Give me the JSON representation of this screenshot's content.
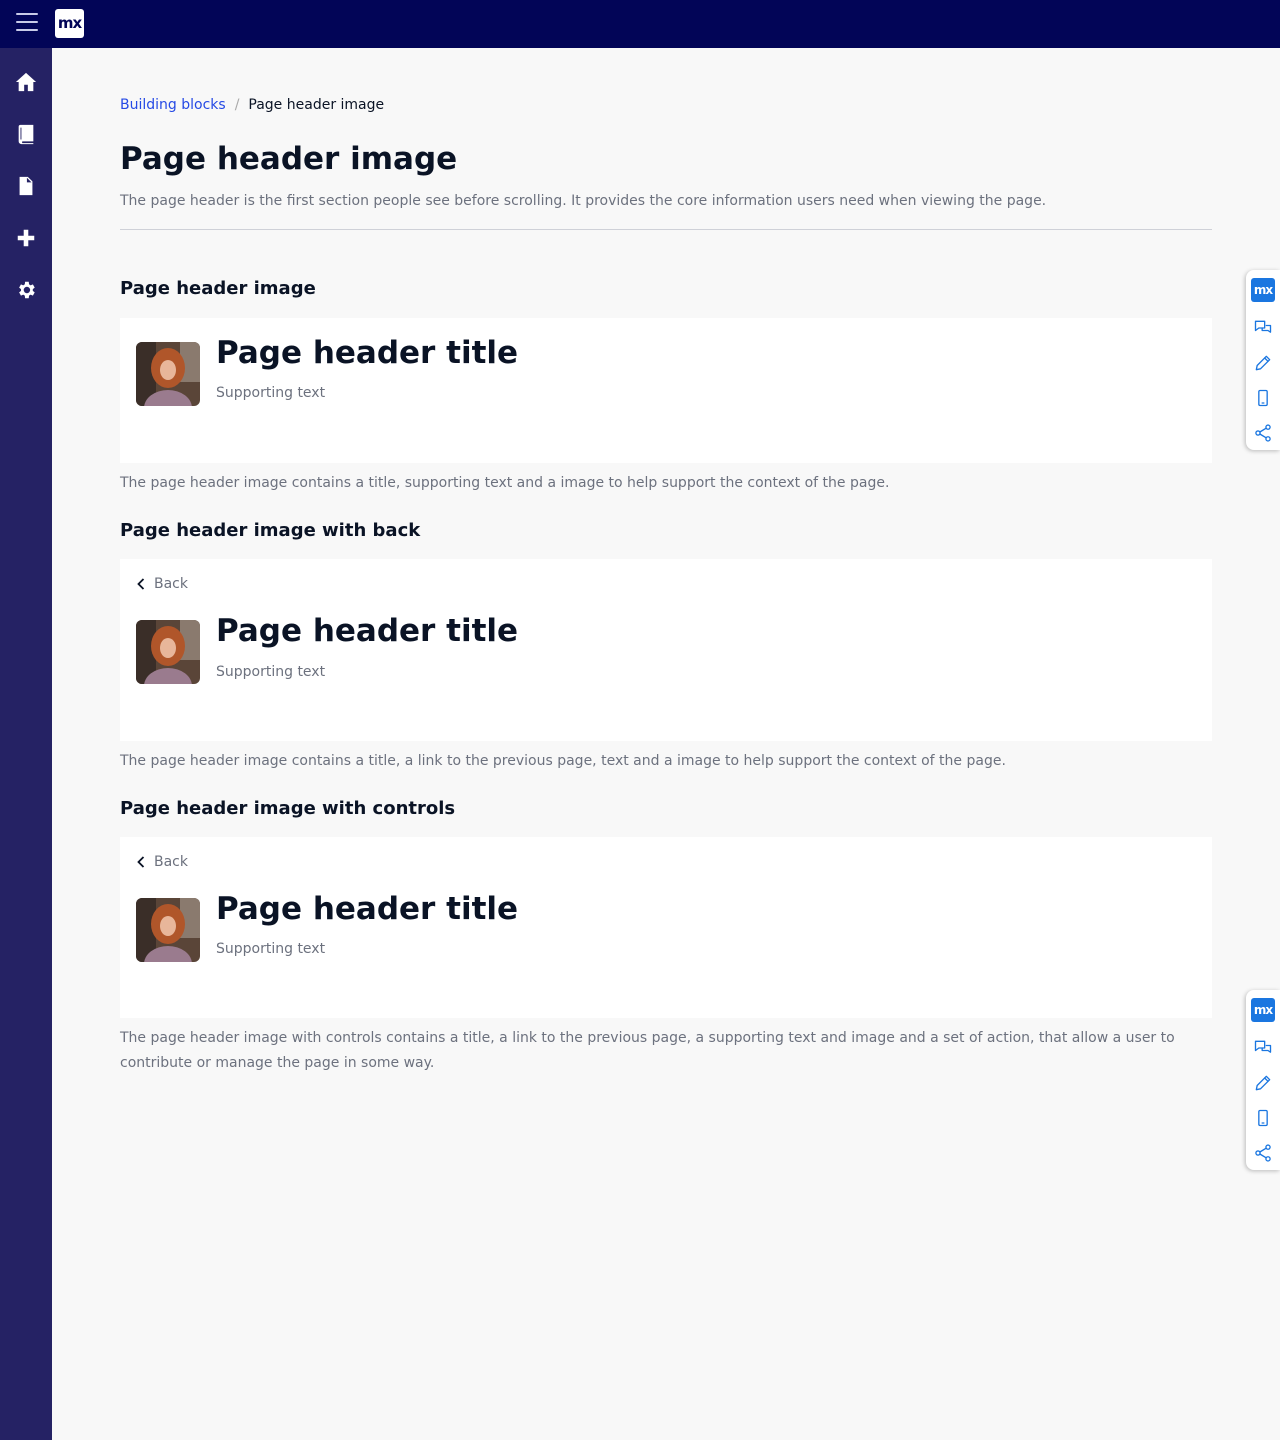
{
  "topbar": {
    "logo": "mx",
    "menu_icon": "hamburger-icon"
  },
  "sidebar": {
    "items": [
      {
        "icon": "home-icon"
      },
      {
        "icon": "book-icon"
      },
      {
        "icon": "document-icon"
      },
      {
        "icon": "plus-icon"
      },
      {
        "icon": "gear-icon"
      }
    ]
  },
  "breadcrumb": {
    "parent": "Building blocks",
    "separator": "/",
    "current": "Page header image"
  },
  "page": {
    "title": "Page header image",
    "description": "The page header is the first section people see before scrolling. It provides the core information users need when viewing the page."
  },
  "sections": [
    {
      "title": "Page header image",
      "card_title": "Page header title",
      "card_sub": "Supporting text",
      "description": "The page header image contains a title, supporting text and a image to help support the context of the page."
    },
    {
      "title": "Page header image with back",
      "back_label": "Back",
      "card_title": "Page header title",
      "card_sub": "Supporting text",
      "description": "The page header image contains a title, a link to the previous page, text and a image to help support the context of the page."
    },
    {
      "title": "Page header image with controls",
      "back_label": "Back",
      "card_title": "Page header title",
      "card_sub": "Supporting text",
      "description": "The page header image with controls contains a title, a link to the previous page, a supporting text and image and a set of action, that allow a user to contribute or manage the page in some way."
    }
  ],
  "floating_toolbar": {
    "logo": "mx",
    "icons": [
      "chat-icon",
      "pencil-icon",
      "mobile-icon",
      "share-icon"
    ]
  },
  "colors": {
    "topbar": "#020557",
    "sidebar": "#252264",
    "link": "#264ae5",
    "accent": "#1a76e0"
  }
}
